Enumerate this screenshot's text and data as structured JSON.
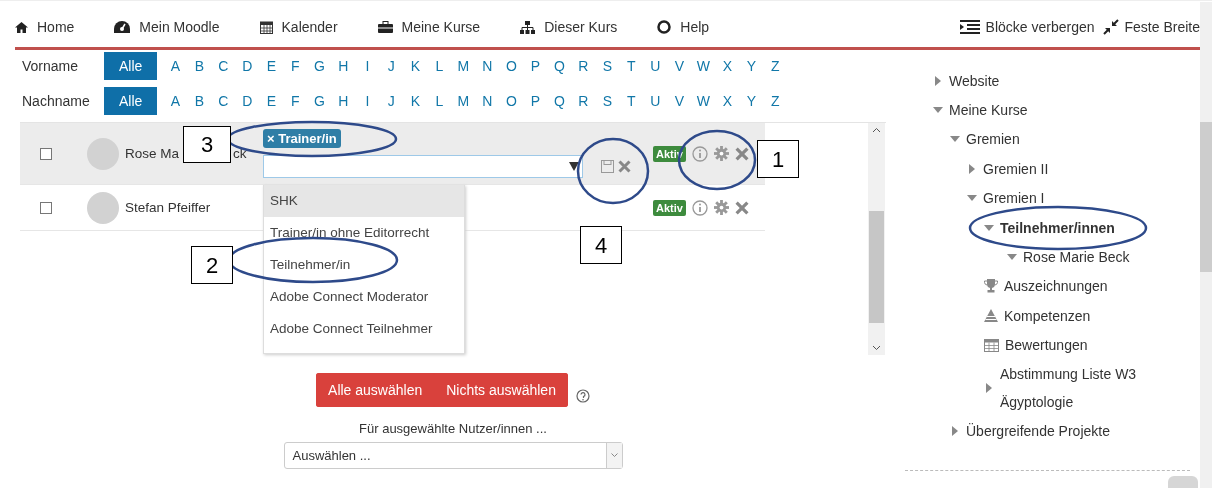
{
  "navbar": {
    "items": [
      {
        "kind": "home",
        "label": "Home"
      },
      {
        "kind": "dashboard",
        "label": "Mein Moodle"
      },
      {
        "kind": "calendar",
        "label": "Kalender"
      },
      {
        "kind": "briefcase",
        "label": "Meine Kurse"
      },
      {
        "kind": "sitemap",
        "label": "Dieser Kurs"
      },
      {
        "kind": "help",
        "label": "Help"
      }
    ],
    "right": [
      {
        "kind": "blocks",
        "label": "Blöcke verbergen"
      },
      {
        "kind": "compress",
        "label": "Feste Breite"
      }
    ]
  },
  "filters": [
    {
      "label": "Vorname",
      "letters": [
        {
          "text": "Alle",
          "selected": true
        },
        {
          "text": "A",
          "selected": false
        },
        {
          "text": "B",
          "selected": false
        },
        {
          "text": "C",
          "selected": false
        },
        {
          "text": "D",
          "selected": false
        },
        {
          "text": "E",
          "selected": false
        },
        {
          "text": "F",
          "selected": false
        },
        {
          "text": "G",
          "selected": false
        },
        {
          "text": "H",
          "selected": false
        },
        {
          "text": "I",
          "selected": false
        },
        {
          "text": "J",
          "selected": false
        },
        {
          "text": "K",
          "selected": false
        },
        {
          "text": "L",
          "selected": false
        },
        {
          "text": "M",
          "selected": false
        },
        {
          "text": "N",
          "selected": false
        },
        {
          "text": "O",
          "selected": false
        },
        {
          "text": "P",
          "selected": false
        },
        {
          "text": "Q",
          "selected": false
        },
        {
          "text": "R",
          "selected": false
        },
        {
          "text": "S",
          "selected": false
        },
        {
          "text": "T",
          "selected": false
        },
        {
          "text": "U",
          "selected": false
        },
        {
          "text": "V",
          "selected": false
        },
        {
          "text": "W",
          "selected": false
        },
        {
          "text": "X",
          "selected": false
        },
        {
          "text": "Y",
          "selected": false
        },
        {
          "text": "Z",
          "selected": false
        }
      ]
    },
    {
      "label": "Nachname",
      "letters": [
        {
          "text": "Alle",
          "selected": true
        },
        {
          "text": "A",
          "selected": false
        },
        {
          "text": "B",
          "selected": false
        },
        {
          "text": "C",
          "selected": false
        },
        {
          "text": "D",
          "selected": false
        },
        {
          "text": "E",
          "selected": false
        },
        {
          "text": "F",
          "selected": false
        },
        {
          "text": "G",
          "selected": false
        },
        {
          "text": "H",
          "selected": false
        },
        {
          "text": "I",
          "selected": false
        },
        {
          "text": "J",
          "selected": false
        },
        {
          "text": "K",
          "selected": false
        },
        {
          "text": "L",
          "selected": false
        },
        {
          "text": "M",
          "selected": false
        },
        {
          "text": "N",
          "selected": false
        },
        {
          "text": "O",
          "selected": false
        },
        {
          "text": "P",
          "selected": false
        },
        {
          "text": "Q",
          "selected": false
        },
        {
          "text": "R",
          "selected": false
        },
        {
          "text": "S",
          "selected": false
        },
        {
          "text": "T",
          "selected": false
        },
        {
          "text": "U",
          "selected": false
        },
        {
          "text": "V",
          "selected": false
        },
        {
          "text": "W",
          "selected": false
        },
        {
          "text": "X",
          "selected": false
        },
        {
          "text": "Y",
          "selected": false
        },
        {
          "text": "Z",
          "selected": false
        }
      ]
    }
  ],
  "participants": [
    {
      "checked": false,
      "selected": true,
      "name_parts": [
        "Rose Ma",
        "ck"
      ],
      "status": "Aktiv",
      "role_editor": {
        "tag": "× Trainer/in",
        "options": [
          {
            "label": "SHK",
            "selected": true
          },
          {
            "label": "Trainer/in ohne Editorrecht",
            "selected": false
          },
          {
            "label": "Teilnehmer/in",
            "selected": false
          },
          {
            "label": "Adobe Connect Moderator",
            "selected": false
          },
          {
            "label": "Adobe Connect Teilnehmer",
            "selected": false
          }
        ]
      }
    },
    {
      "checked": false,
      "selected": false,
      "name_parts": [
        "Stefan Pfeiffer"
      ],
      "status": "Aktiv"
    }
  ],
  "bulk": {
    "buttons": [
      "Alle auswählen",
      "Nichts auswählen"
    ],
    "caption": "Für ausgewählte Nutzer/innen ...",
    "select": {
      "value": "Auswählen ..."
    }
  },
  "navigation": [
    {
      "label": "Website",
      "kind": "node",
      "expanded": false,
      "selected": false
    },
    {
      "label": "Meine Kurse",
      "kind": "node",
      "expanded": true,
      "selected": false,
      "children": [
        {
          "label": "Gremien",
          "kind": "node",
          "expanded": true,
          "selected": false,
          "children": [
            {
              "label": "Gremien II",
              "kind": "node",
              "expanded": false,
              "selected": false
            },
            {
              "label": "Gremien I",
              "kind": "node",
              "expanded": true,
              "selected": false,
              "children": [
                {
                  "label": "Teilnehmer/innen",
                  "kind": "node",
                  "expanded": true,
                  "selected": true,
                  "children": [
                    {
                      "label": "Rose Marie Beck",
                      "kind": "user",
                      "selected": false
                    }
                  ]
                },
                {
                  "label": "Auszeichnungen",
                  "kind": "award",
                  "selected": false
                },
                {
                  "label": "Kompetenzen",
                  "kind": "competency",
                  "selected": false
                },
                {
                  "label": "Bewertungen",
                  "kind": "grades",
                  "selected": false
                },
                {
                  "label": "Abstimmung Liste W3 Ägyptologie",
                  "kind": "node",
                  "expanded": false,
                  "selected": false
                }
              ]
            }
          ]
        },
        {
          "label": "Übergreifende Projekte",
          "kind": "node",
          "expanded": false,
          "selected": false
        }
      ]
    }
  ],
  "annotations": [
    {
      "label": "1"
    },
    {
      "label": "2"
    },
    {
      "label": "3"
    },
    {
      "label": "4"
    }
  ]
}
